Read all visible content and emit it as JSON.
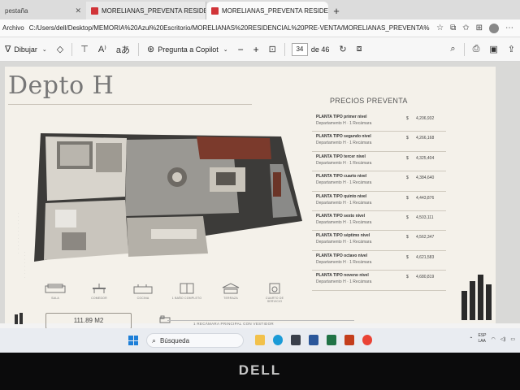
{
  "browser": {
    "tabs": [
      {
        "title": "pestaña"
      },
      {
        "title": "MORELIANAS_PREVENTA RESIDEN"
      },
      {
        "title": "MORELIANAS_PREVENTA RESIDE"
      }
    ],
    "address_label": "Archivo",
    "address_url": "C:/Users/dell/Desktop/MEMORIA%20Azul%20Escritorio/MORELIANAS%20RESIDENCIAL%20PRE-VENTA/MORELIANAS_PREVENTA%..."
  },
  "pdf_toolbar": {
    "draw_label": "Dibujar",
    "copilot_label": "Pregunta a Copilot",
    "zoom_minus": "−",
    "zoom_plus": "+",
    "page_current": "34",
    "page_total": "de 46"
  },
  "document": {
    "title": "Depto H",
    "precios_title": "PRECIOS PREVENTA",
    "prices": [
      {
        "name": "PLANTA TIPO primer nivel",
        "sub": "Departamento H · 1 Recámara",
        "currency": "$",
        "value": "4,206,932"
      },
      {
        "name": "PLANTA TIPO segundo nivel",
        "sub": "Departamento H · 1 Recámara",
        "currency": "$",
        "value": "4,266,168"
      },
      {
        "name": "PLANTA TIPO tercer nivel",
        "sub": "Departamento H · 1 Recámara",
        "currency": "$",
        "value": "4,325,404"
      },
      {
        "name": "PLANTA TIPO cuarto nivel",
        "sub": "Departamento H · 1 Recámara",
        "currency": "$",
        "value": "4,384,640"
      },
      {
        "name": "PLANTA TIPO quinto nivel",
        "sub": "Departamento H · 1 Recámara",
        "currency": "$",
        "value": "4,443,876"
      },
      {
        "name": "PLANTA TIPO sexto nivel",
        "sub": "Departamento H · 1 Recámara",
        "currency": "$",
        "value": "4,503,111"
      },
      {
        "name": "PLANTA TIPO séptimo nivel",
        "sub": "Departamento H · 1 Recámara",
        "currency": "$",
        "value": "4,562,347"
      },
      {
        "name": "PLANTA TIPO octavo nivel",
        "sub": "Departamento H · 1 Recámara",
        "currency": "$",
        "value": "4,621,583"
      },
      {
        "name": "PLANTA TIPO noveno nivel",
        "sub": "Departamento H · 1 Recámara",
        "currency": "$",
        "value": "4,680,819"
      }
    ],
    "amenities": [
      {
        "label": "SALA",
        "icon": "sofa-icon"
      },
      {
        "label": "COMEDOR",
        "icon": "dining-icon"
      },
      {
        "label": "COCINA",
        "icon": "kitchen-icon"
      },
      {
        "label": "1 BAÑO COMPLETO",
        "icon": "bathroom-icon"
      },
      {
        "label": "TERRAZA",
        "icon": "terrace-icon"
      },
      {
        "label": "CUARTO DE SERVICIO",
        "icon": "laundry-icon"
      }
    ],
    "area": "111.89 M2",
    "bedroom_text": "1 RECÁMARA PRINCIPAL CON VESTIDOR"
  },
  "taskbar": {
    "search_placeholder": "Búsqueda",
    "lang_top": "ESP",
    "lang_bottom": "LAA"
  },
  "brand": "DELL"
}
